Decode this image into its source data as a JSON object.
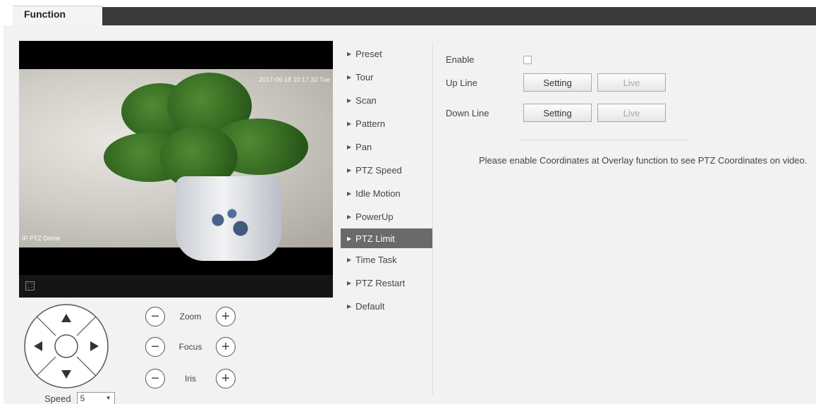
{
  "header": {
    "tab_label": "Function"
  },
  "video": {
    "timestamp": "2017-06-18 10:17:32 Tue",
    "osd_label": "IP PTZ Dome"
  },
  "ptz": {
    "zoom_label": "Zoom",
    "focus_label": "Focus",
    "iris_label": "Iris",
    "speed_label": "Speed",
    "speed_value": "5"
  },
  "menu": {
    "items": [
      {
        "label": "Preset"
      },
      {
        "label": "Tour"
      },
      {
        "label": "Scan"
      },
      {
        "label": "Pattern"
      },
      {
        "label": "Pan"
      },
      {
        "label": "PTZ Speed"
      },
      {
        "label": "Idle Motion"
      },
      {
        "label": "PowerUp"
      },
      {
        "label": "PTZ Limit",
        "active": true
      },
      {
        "label": "Time Task"
      },
      {
        "label": "PTZ Restart"
      },
      {
        "label": "Default"
      }
    ]
  },
  "settings": {
    "enable_label": "Enable",
    "enable_checked": false,
    "up_line_label": "Up Line",
    "down_line_label": "Down Line",
    "setting_button": "Setting",
    "live_button": "Live",
    "note": "Please enable Coordinates at Overlay function to see PTZ Coordinates on video."
  }
}
